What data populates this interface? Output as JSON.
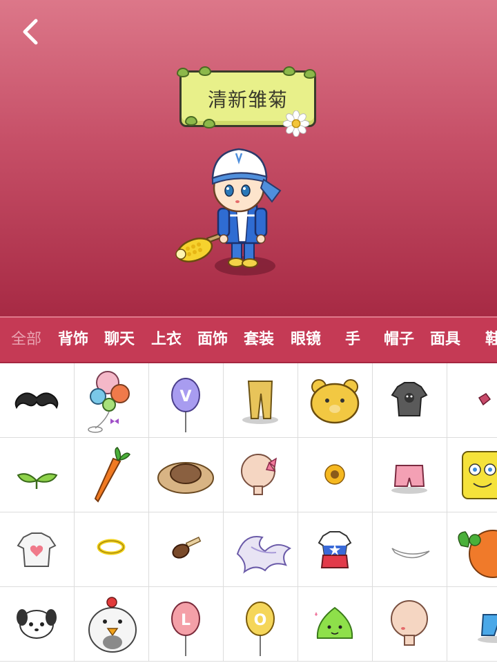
{
  "character": {
    "title": "清新雏菊"
  },
  "tabs": [
    {
      "label": "全部",
      "active": true
    },
    {
      "label": "背饰",
      "active": false
    },
    {
      "label": "聊天",
      "active": false
    },
    {
      "label": "上衣",
      "active": false
    },
    {
      "label": "面饰",
      "active": false
    },
    {
      "label": "套装",
      "active": false
    },
    {
      "label": "眼镜",
      "active": false
    },
    {
      "label": "手",
      "active": false
    },
    {
      "label": "帽子",
      "active": false
    },
    {
      "label": "面具",
      "active": false
    },
    {
      "label": "鞋",
      "active": false
    }
  ],
  "items": [
    {
      "icon": "mustache-icon"
    },
    {
      "icon": "heart-balloons-icon"
    },
    {
      "icon": "balloon-v-icon",
      "letter": "V"
    },
    {
      "icon": "yellow-pants-icon"
    },
    {
      "icon": "bear-hat-icon"
    },
    {
      "icon": "gray-shirt-icon"
    },
    {
      "icon": "small-red-item-icon"
    },
    {
      "icon": "sprout-icon"
    },
    {
      "icon": "carrot-icon"
    },
    {
      "icon": "straw-hat-icon"
    },
    {
      "icon": "ribbon-head-icon"
    },
    {
      "icon": "sunflower-icon"
    },
    {
      "icon": "pink-shorts-icon"
    },
    {
      "icon": "sponge-icon"
    },
    {
      "icon": "heart-shirt-icon"
    },
    {
      "icon": "halo-icon"
    },
    {
      "icon": "chocolate-icecream-icon"
    },
    {
      "icon": "nine-tails-icon"
    },
    {
      "icon": "star-shirt-icon"
    },
    {
      "icon": "white-feather-icon"
    },
    {
      "icon": "carrot-house-icon"
    },
    {
      "icon": "panda-dog-mask-icon"
    },
    {
      "icon": "chicken-hat-icon"
    },
    {
      "icon": "balloon-l-icon",
      "letter": "L"
    },
    {
      "icon": "balloon-o-icon",
      "letter": "O"
    },
    {
      "icon": "green-slime-icon"
    },
    {
      "icon": "blank-head-icon"
    },
    {
      "icon": "blue-shorts-icon"
    }
  ],
  "colors": {
    "header_top": "#dc7789",
    "header_bottom": "#a72a44",
    "tab_bar": "#c53a55",
    "tab_active_text": "#e9a3b1",
    "nameplate": "#e8f08a"
  }
}
